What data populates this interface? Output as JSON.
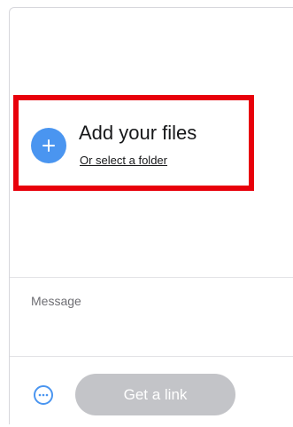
{
  "upload": {
    "title": "Add your files",
    "folder_link": "Or select a folder"
  },
  "message": {
    "placeholder": "Message",
    "value": ""
  },
  "footer": {
    "get_link_label": "Get a link"
  },
  "icons": {
    "add": "plus-icon",
    "options": "more-horizontal-icon"
  },
  "colors": {
    "accent": "#4a95f0",
    "highlight": "#e8000b",
    "button_disabled": "#c3c4c8"
  }
}
